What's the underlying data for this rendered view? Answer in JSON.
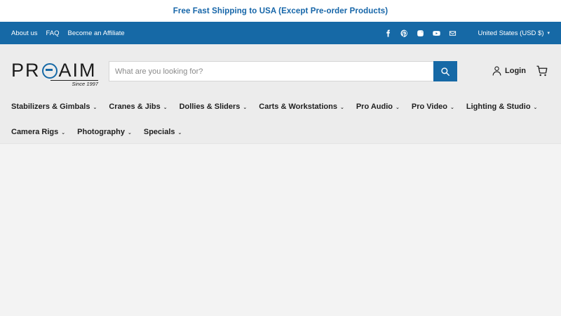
{
  "announcement": {
    "text": "Free Fast Shipping to USA (Except Pre-order Products)"
  },
  "utility_bar": {
    "links": [
      "About us",
      "FAQ",
      "Become an Affiliate"
    ],
    "social_icons": [
      "facebook-icon",
      "pinterest-icon",
      "instagram-icon",
      "youtube-icon",
      "email-icon"
    ],
    "currency": "United States (USD $)"
  },
  "header": {
    "logo_text_1": "PR",
    "logo_text_2": "AIM",
    "logo_since": "Since 1997",
    "search_placeholder": "What are you looking for?",
    "login_label": "Login"
  },
  "nav": {
    "row1": [
      "Stabilizers & Gimbals",
      "Cranes & Jibs",
      "Dollies & Sliders",
      "Carts & Workstations",
      "Pro Audio",
      "Pro Video",
      "Lighting & Studio"
    ],
    "row2": [
      "Camera Rigs",
      "Photography",
      "Specials"
    ]
  },
  "colors": {
    "brand_blue": "#1669a6",
    "header_bg": "#ececec",
    "page_bg": "#f3f3f3"
  }
}
